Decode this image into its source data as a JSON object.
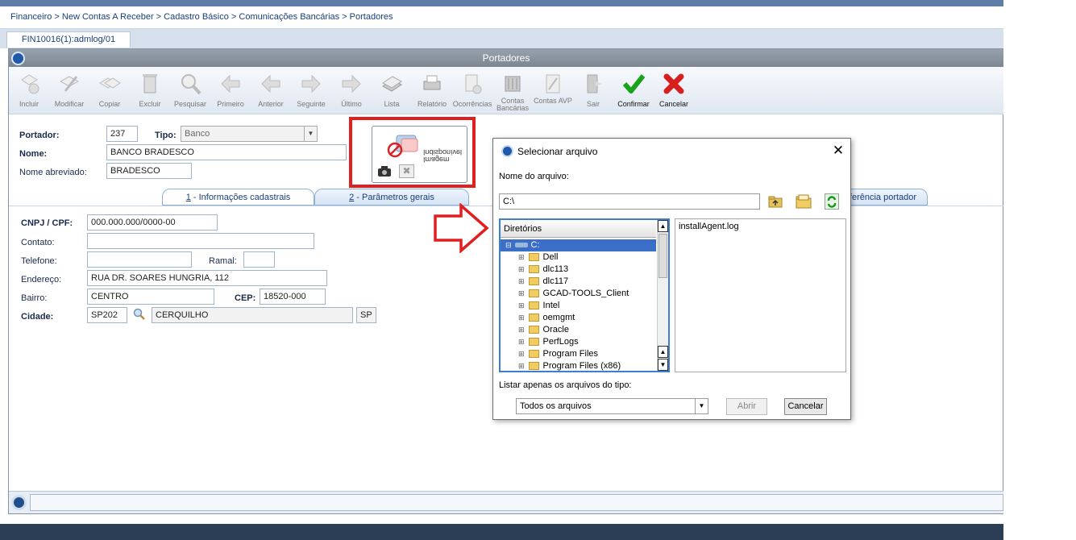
{
  "breadcrumb": "Financeiro > New Contas A Receber > Cadastro Básico > Comunicações Bancárias > Portadores",
  "program_tab": "FIN10016(1):admlog/01",
  "window_title": "Portadores",
  "toolbar": [
    {
      "label": "Incluir",
      "icon": "add-icon",
      "enabled": false
    },
    {
      "label": "Modificar",
      "icon": "edit-icon",
      "enabled": false
    },
    {
      "label": "Copiar",
      "icon": "copy-icon",
      "enabled": false
    },
    {
      "label": "Excluir",
      "icon": "trash-icon",
      "enabled": false
    },
    {
      "label": "Pesquisar",
      "icon": "search-icon",
      "enabled": false
    },
    {
      "label": "Primeiro",
      "icon": "first-icon",
      "enabled": false
    },
    {
      "label": "Anterior",
      "icon": "previous-icon",
      "enabled": false
    },
    {
      "label": "Seguinte",
      "icon": "next-icon",
      "enabled": false
    },
    {
      "label": "Último",
      "icon": "last-icon",
      "enabled": false
    },
    {
      "label": "Lista",
      "icon": "list-icon",
      "enabled": false
    },
    {
      "label": "Relatório",
      "icon": "printer-icon",
      "enabled": false
    },
    {
      "label": "Ocorrências",
      "icon": "occurrences-icon",
      "enabled": false
    },
    {
      "label": "Contas Bancárias",
      "icon": "bank-icon",
      "enabled": false
    },
    {
      "label": "Contas AVP",
      "icon": "avp-icon",
      "enabled": false
    },
    {
      "label": "Sair",
      "icon": "exit-icon",
      "enabled": false
    },
    {
      "label": "Confirmar",
      "icon": "check-icon",
      "enabled": true
    },
    {
      "label": "Cancelar",
      "icon": "cancel-x-icon",
      "enabled": true
    }
  ],
  "header": {
    "portador_label": "Portador:",
    "portador_value": "237",
    "tipo_label": "Tipo:",
    "tipo_value": "Banco",
    "nome_label": "Nome:",
    "nome_value": "BANCO BRADESCO",
    "nome_abrev_label": "Nome abreviado:",
    "nome_abrev_value": "BRADESCO",
    "image_placeholder_text": "Imagem Indisponível"
  },
  "tabs": [
    {
      "num": "1",
      "label": " - Informações cadastrais",
      "active": true
    },
    {
      "num": "2",
      "label": " - Parâmetros gerais",
      "active": false
    },
    {
      "num": "",
      "label": "ferência portador",
      "active": false
    }
  ],
  "form": {
    "cnpj_label": "CNPJ / CPF:",
    "cnpj_value": "000.000.000/0000-00",
    "contato_label": "Contato:",
    "contato_value": "",
    "telefone_label": "Telefone:",
    "telefone_value": "",
    "ramal_label": "Ramal:",
    "ramal_value": "",
    "endereco_label": "Endereço:",
    "endereco_value": "RUA DR. SOARES HUNGRIA, 112",
    "bairro_label": "Bairro:",
    "bairro_value": "CENTRO",
    "cep_label": "CEP:",
    "cep_value": "18520-000",
    "cidade_label": "Cidade:",
    "cidade_code": "SP202",
    "cidade_name": "CERQUILHO",
    "uf": "SP"
  },
  "dialog": {
    "title": "Selecionar arquivo",
    "filename_label": "Nome do arquivo:",
    "path_value": "C:\\",
    "dirs_header": "Diretórios",
    "drive": "C:",
    "folders": [
      "Dell",
      "dlc113",
      "dlc117",
      "GCAD-TOOLS_Client",
      "Intel",
      "oemgmt",
      "Oracle",
      "PerfLogs",
      "Program Files",
      "Program Files (x86)"
    ],
    "files": [
      "installAgent.log"
    ],
    "filetype_label": "Listar apenas os arquivos do tipo:",
    "filetype_value": "Todos os arquivos",
    "open_button": "Abrir",
    "cancel_button": "Cancelar"
  },
  "colors": {
    "accent": "#1a3f78",
    "annotation_red": "#e02020",
    "confirm_green": "#1aa31a",
    "cancel_red": "#d61f1f"
  }
}
